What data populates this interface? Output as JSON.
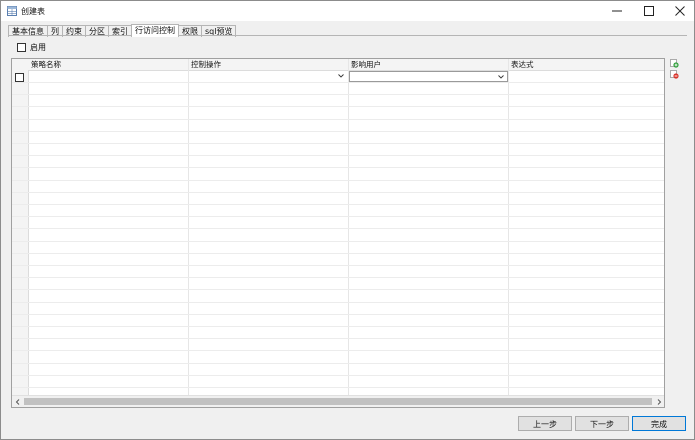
{
  "window": {
    "title": "创建表",
    "icon": "table-icon",
    "controls": [
      "minimize-icon",
      "maximize-icon",
      "close-icon"
    ]
  },
  "tabs": [
    {
      "label": "基本信息",
      "active": false
    },
    {
      "label": "列",
      "active": false
    },
    {
      "label": "约束",
      "active": false
    },
    {
      "label": "分区",
      "active": false
    },
    {
      "label": "索引",
      "active": false
    },
    {
      "label": "行访问控制",
      "active": true
    },
    {
      "label": "权限",
      "active": false
    },
    {
      "label": "sql预览",
      "active": false
    }
  ],
  "enable": {
    "label": "启用",
    "checked": false
  },
  "grid": {
    "columns": [
      "策略名称",
      "控制操作",
      "影响用户",
      "表达式"
    ],
    "rows": [
      {
        "checked": false,
        "policy_name": "",
        "operation": "",
        "users": "",
        "expression": ""
      }
    ]
  },
  "side_actions": [
    "add-row-icon",
    "delete-row-icon"
  ],
  "buttons": {
    "prev": "上一步",
    "next": "下一步",
    "finish": "完成"
  },
  "colors": {
    "accent": "#0078d7",
    "add_icon": "#2e9e3a",
    "delete_icon": "#d9342b"
  }
}
